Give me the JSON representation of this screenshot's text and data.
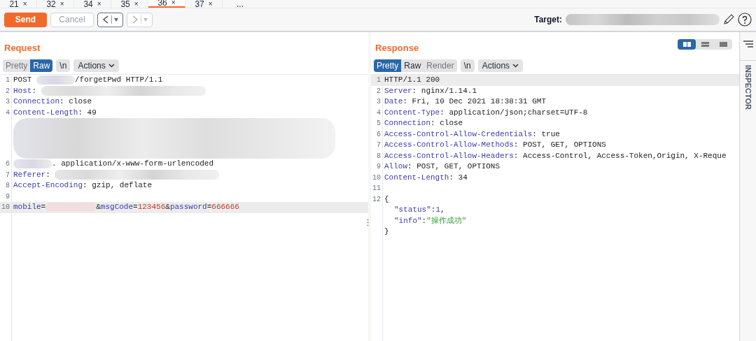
{
  "tabs": [
    {
      "label": "21",
      "close": "×",
      "selected": false
    },
    {
      "label": "32",
      "close": "×",
      "selected": false
    },
    {
      "label": "34",
      "close": "×",
      "selected": false
    },
    {
      "label": "35",
      "close": "×",
      "selected": false
    },
    {
      "label": "36",
      "close": "×",
      "selected": true
    },
    {
      "label": "37",
      "close": "×",
      "selected": false
    }
  ],
  "tabs_more": "...",
  "toolbar": {
    "send": "Send",
    "cancel": "Cancel",
    "target_label": "Target:"
  },
  "views": [
    {
      "selected": true
    },
    {
      "selected": false
    },
    {
      "selected": false
    }
  ],
  "request": {
    "title": "Request",
    "modes": [
      {
        "label": "Pretty",
        "selected": false,
        "disabled": true
      },
      {
        "label": "Raw",
        "selected": true,
        "disabled": false
      }
    ],
    "newline": "\\n",
    "actions": "Actions",
    "lines": [
      {
        "num": "1",
        "highlighted": false,
        "segments": [
          {
            "kind": "text",
            "text": "POST "
          },
          {
            "kind": "blur_short"
          },
          {
            "kind": "text",
            "text": "/forgetPwd HTTP/1.1"
          }
        ]
      },
      {
        "num": "2",
        "highlighted": false,
        "segments": [
          {
            "kind": "key",
            "text": "Host"
          },
          {
            "kind": "text",
            "text": ": "
          },
          {
            "kind": "blur_long"
          }
        ]
      },
      {
        "num": "3",
        "highlighted": false,
        "segments": [
          {
            "kind": "key",
            "text": "Connection"
          },
          {
            "kind": "text",
            "text": ": close"
          }
        ]
      },
      {
        "num": "4",
        "highlighted": false,
        "segments": [
          {
            "kind": "key",
            "text": "Content-Length"
          },
          {
            "kind": "text",
            "text": ": 49"
          }
        ]
      },
      {
        "highlighted": false,
        "segments": [
          {
            "kind": "blur_block"
          }
        ]
      },
      {
        "num": "6",
        "highlighted": false,
        "segments": [
          {
            "kind": "blur_short"
          },
          {
            "kind": "text",
            "text": ". application/x-www-form-urlencoded"
          }
        ]
      },
      {
        "num": "7",
        "highlighted": false,
        "segments": [
          {
            "kind": "key",
            "text": "Referer"
          },
          {
            "kind": "text",
            "text": ": "
          },
          {
            "kind": "blur_long"
          }
        ]
      },
      {
        "num": "8",
        "highlighted": false,
        "segments": [
          {
            "kind": "key",
            "text": "Accept-Encoding"
          },
          {
            "kind": "text",
            "text": ": gzip, deflate"
          }
        ]
      },
      {
        "num": "9",
        "highlighted": false
      },
      {
        "num": "10",
        "highlighted": true,
        "segments": [
          {
            "kind": "key",
            "text": "mobile"
          },
          {
            "kind": "text",
            "text": "="
          },
          {
            "kind": "blur_red"
          },
          {
            "kind": "text",
            "text": "&"
          },
          {
            "kind": "key",
            "text": "msgCode"
          },
          {
            "kind": "text",
            "text": "="
          },
          {
            "kind": "num",
            "text": "123456"
          },
          {
            "kind": "text",
            "text": "&"
          },
          {
            "kind": "key",
            "text": "password"
          },
          {
            "kind": "text",
            "text": "="
          },
          {
            "kind": "num",
            "text": "666666"
          }
        ]
      }
    ]
  },
  "response": {
    "title": "Response",
    "modes": [
      {
        "label": "Pretty",
        "selected": true,
        "disabled": false
      },
      {
        "label": "Raw",
        "selected": false,
        "disabled": false
      },
      {
        "label": "Render",
        "selected": false,
        "disabled": true
      }
    ],
    "newline": "\\n",
    "actions": "Actions",
    "lines": [
      {
        "num": "1",
        "highlighted": true,
        "segments": [
          {
            "kind": "text",
            "text": "HTTP/1.1 200"
          }
        ]
      },
      {
        "num": "2",
        "highlighted": false,
        "segments": [
          {
            "kind": "key",
            "text": "Server"
          },
          {
            "kind": "text",
            "text": ": nginx/1.14.1"
          }
        ]
      },
      {
        "num": "3",
        "highlighted": false,
        "segments": [
          {
            "kind": "key",
            "text": "Date"
          },
          {
            "kind": "text",
            "text": ": Fri, 10 Dec 2021 18:38:31 GMT"
          }
        ]
      },
      {
        "num": "4",
        "highlighted": false,
        "segments": [
          {
            "kind": "key",
            "text": "Content-Type"
          },
          {
            "kind": "text",
            "text": ": application/json;charset=UTF-8"
          }
        ]
      },
      {
        "num": "5",
        "highlighted": false,
        "segments": [
          {
            "kind": "key",
            "text": "Connection"
          },
          {
            "kind": "text",
            "text": ": close"
          }
        ]
      },
      {
        "num": "6",
        "highlighted": false,
        "segments": [
          {
            "kind": "key",
            "text": "Access-Control-Allow-Credentials"
          },
          {
            "kind": "text",
            "text": ": true"
          }
        ]
      },
      {
        "num": "7",
        "highlighted": false,
        "segments": [
          {
            "kind": "key",
            "text": "Access-Control-Allow-Methods"
          },
          {
            "kind": "text",
            "text": ": POST, GET, OPTIONS"
          }
        ]
      },
      {
        "num": "8",
        "highlighted": false,
        "segments": [
          {
            "kind": "key",
            "text": "Access-Control-Allow-Headers"
          },
          {
            "kind": "text",
            "text": ": Access-Control, Access-Token,Origin, X-Reque"
          }
        ]
      },
      {
        "num": "9",
        "highlighted": false,
        "segments": [
          {
            "kind": "key",
            "text": "Allow"
          },
          {
            "kind": "text",
            "text": ": POST, GET, OPTIONS"
          }
        ]
      },
      {
        "num": "10",
        "highlighted": false,
        "segments": [
          {
            "kind": "key",
            "text": "Content-Length"
          },
          {
            "kind": "text",
            "text": ": 34"
          }
        ]
      },
      {
        "num": "11",
        "highlighted": false
      },
      {
        "num": "12",
        "highlighted": false,
        "segments": [
          {
            "kind": "text",
            "text": "{"
          }
        ]
      },
      {
        "highlighted": false,
        "indent": true,
        "segments": [
          {
            "kind": "key",
            "text": "\"status\""
          },
          {
            "kind": "text",
            "text": ":"
          },
          {
            "kind": "key",
            "text": "1"
          },
          {
            "kind": "text",
            "text": ","
          }
        ]
      },
      {
        "highlighted": false,
        "indent": true,
        "segments": [
          {
            "kind": "key",
            "text": "\"info\""
          },
          {
            "kind": "text",
            "text": ":"
          },
          {
            "kind": "str",
            "text": "\"操作成功\""
          }
        ]
      },
      {
        "highlighted": false,
        "segments": [
          {
            "kind": "text",
            "text": "}"
          }
        ]
      }
    ]
  },
  "inspector": {
    "label": "INSPECTOR"
  }
}
